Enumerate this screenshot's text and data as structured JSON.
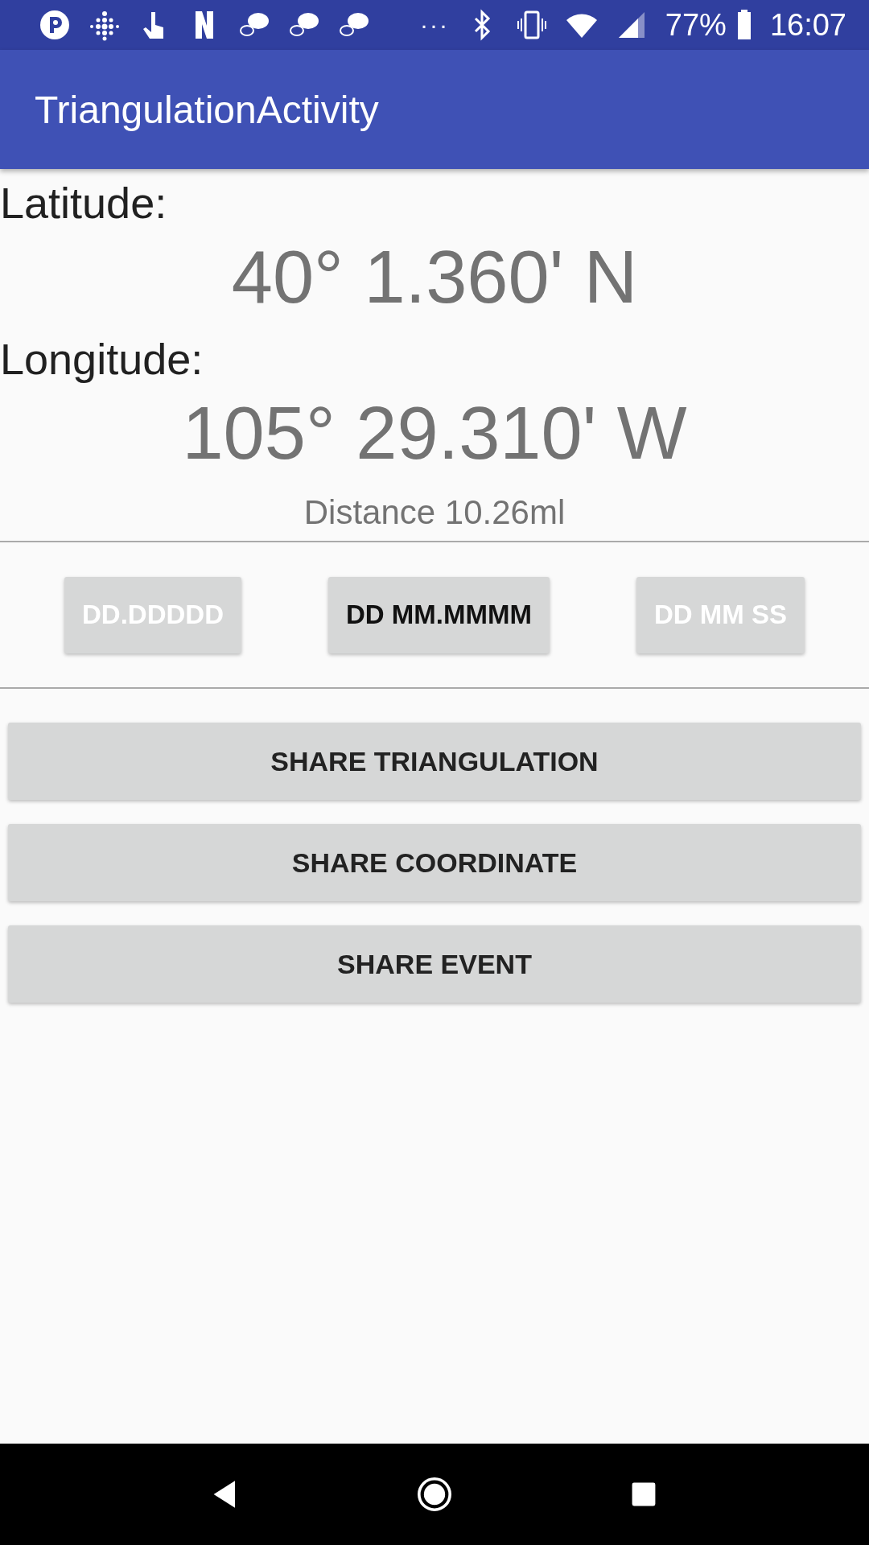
{
  "status_bar": {
    "battery": "77%",
    "time": "16:07",
    "more": "···"
  },
  "app_bar": {
    "title": "TriangulationActivity"
  },
  "latitude": {
    "label": "Latitude:",
    "value": "40° 1.360' N"
  },
  "longitude": {
    "label": "Longitude:",
    "value": "105° 29.310' W"
  },
  "distance": "Distance 10.26ml",
  "formats": [
    {
      "label": "DD.DDDDD",
      "selected": false
    },
    {
      "label": "DD MM.MMMM",
      "selected": true
    },
    {
      "label": "DD MM SS",
      "selected": false
    }
  ],
  "actions": [
    "SHARE TRIANGULATION",
    "SHARE COORDINATE",
    "SHARE EVENT"
  ]
}
